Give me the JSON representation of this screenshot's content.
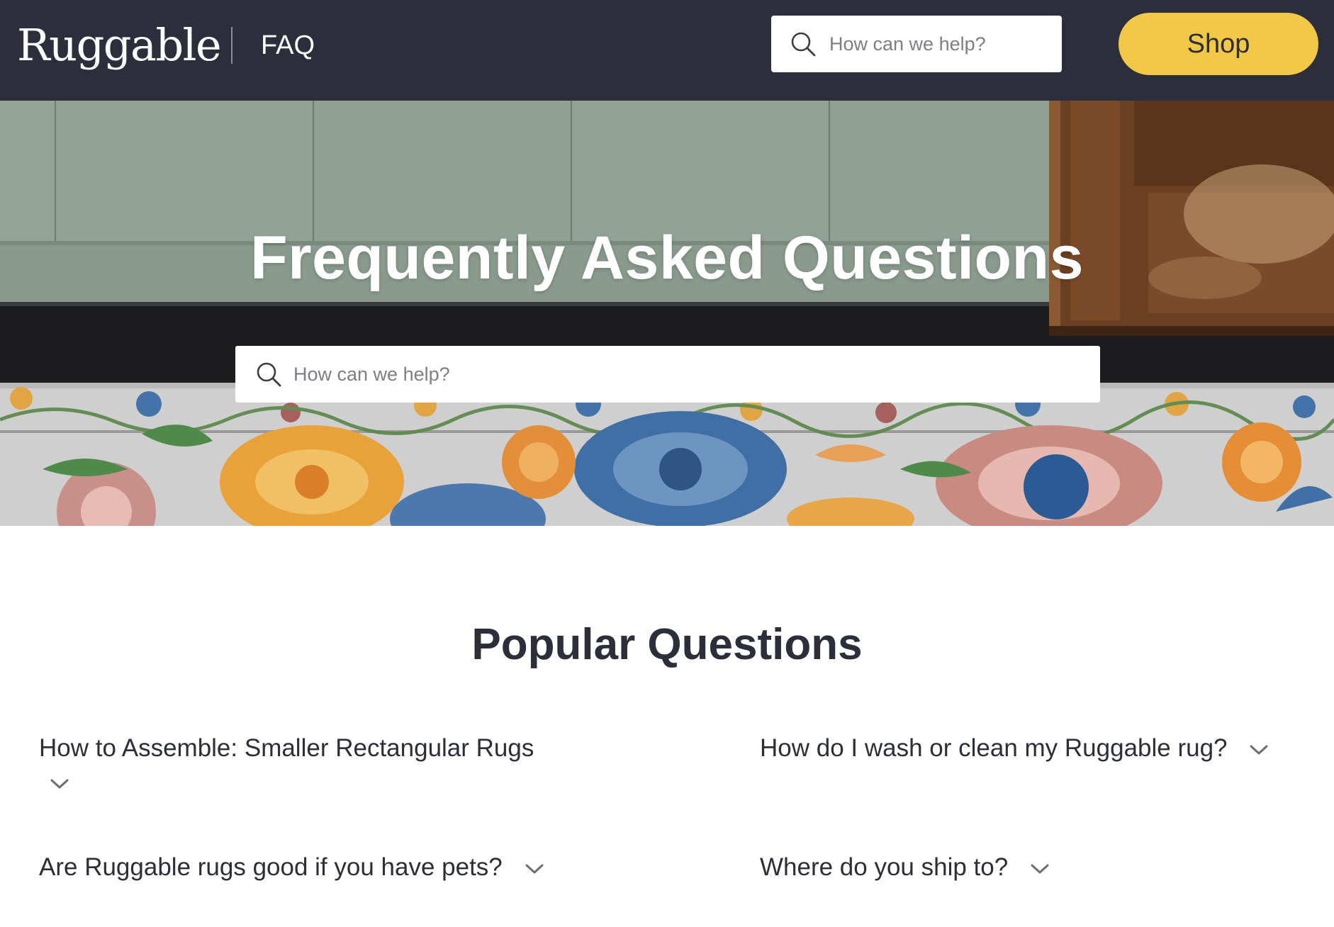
{
  "header": {
    "logo_text": "Ruggable",
    "section_label": "FAQ",
    "search_placeholder": "How can we help?",
    "shop_label": "Shop"
  },
  "hero": {
    "title": "Frequently Asked Questions",
    "search_placeholder": "How can we help?"
  },
  "popular": {
    "title": "Popular Questions",
    "questions": [
      {
        "label": "How to Assemble: Smaller Rectangular Rugs"
      },
      {
        "label": "How do I wash or clean my Ruggable rug?"
      },
      {
        "label": "Are Ruggable rugs good if you have pets?"
      },
      {
        "label": "Where do you ship to?"
      }
    ]
  },
  "icons": {
    "search": "search-icon",
    "expand": "chevron-down-icon"
  },
  "colors": {
    "header_bg": "#2c2f3b",
    "shop_button": "#f3c847",
    "text_dark": "#2c2f3a",
    "wall_green": "#8fa092"
  }
}
